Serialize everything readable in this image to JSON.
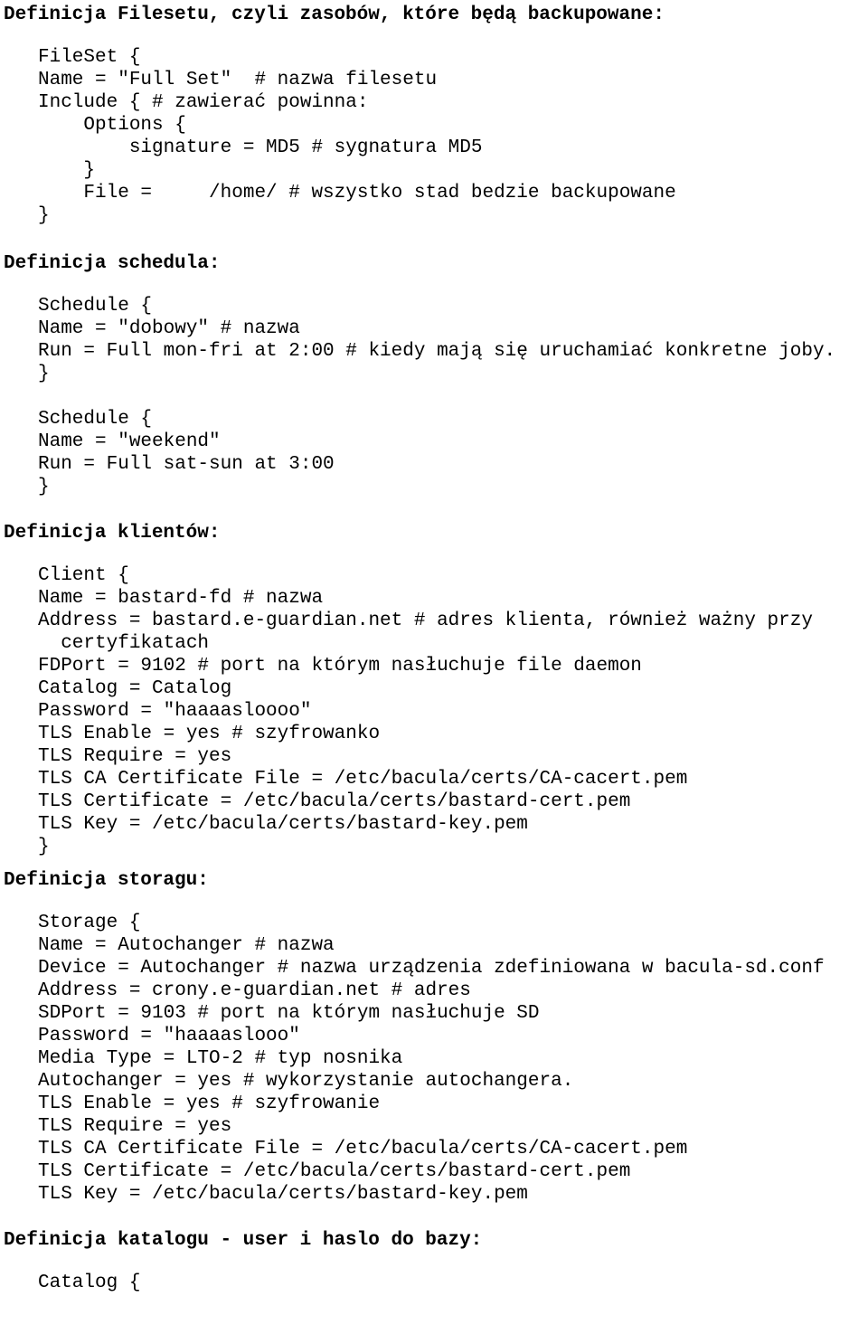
{
  "document": {
    "type": "bacula-configuration-notes",
    "language": "pl"
  },
  "sections": [
    {
      "id": "fileset",
      "heading": "Definicja Filesetu, czyli zasobów, które będą backupowane:",
      "code": "FileSet {\nName = \"Full Set\"  # nazwa filesetu\nInclude { # zawierać powinna:\n    Options {\n        signature = MD5 # sygnatura MD5\n    }\n    File =     /home/ # wszystko stad bedzie backupowane\n}"
    },
    {
      "id": "schedule",
      "heading": "Definicja schedula:",
      "code": "Schedule {\nName = \"dobowy\" # nazwa\nRun = Full mon-fri at 2:00 # kiedy mają się uruchamiać konkretne joby.\n}\n\nSchedule {\nName = \"weekend\"\nRun = Full sat-sun at 3:00\n}"
    },
    {
      "id": "clients",
      "heading": "Definicja klientów:",
      "code": "Client {\nName = bastard-fd # nazwa\nAddress = bastard.e-guardian.net # adres klienta, również ważny przy\n  certyfikatach\nFDPort = 9102 # port na którym nasłuchuje file daemon\nCatalog = Catalog\nPassword = \"haaaasloooo\"\nTLS Enable = yes # szyfrowanko\nTLS Require = yes\nTLS CA Certificate File = /etc/bacula/certs/CA-cacert.pem\nTLS Certificate = /etc/bacula/certs/bastard-cert.pem\nTLS Key = /etc/bacula/certs/bastard-key.pem\n}"
    },
    {
      "id": "storage",
      "heading": "Definicja storagu:",
      "code": "Storage {\nName = Autochanger # nazwa\nDevice = Autochanger # nazwa urządzenia zdefiniowana w bacula-sd.conf\nAddress = crony.e-guardian.net # adres\nSDPort = 9103 # port na którym nasłuchuje SD\nPassword = \"haaaaslooo\"\nMedia Type = LTO-2 # typ nosnika\nAutochanger = yes # wykorzystanie autochangera.\nTLS Enable = yes # szyfrowanie\nTLS Require = yes\nTLS CA Certificate File = /etc/bacula/certs/CA-cacert.pem\nTLS Certificate = /etc/bacula/certs/bastard-cert.pem\nTLS Key = /etc/bacula/certs/bastard-key.pem"
    },
    {
      "id": "catalog",
      "heading": "Definicja katalogu - user i haslo do bazy:",
      "code": "Catalog {"
    }
  ],
  "colors": {
    "page_background": "#ffffff",
    "text": "#000000"
  }
}
